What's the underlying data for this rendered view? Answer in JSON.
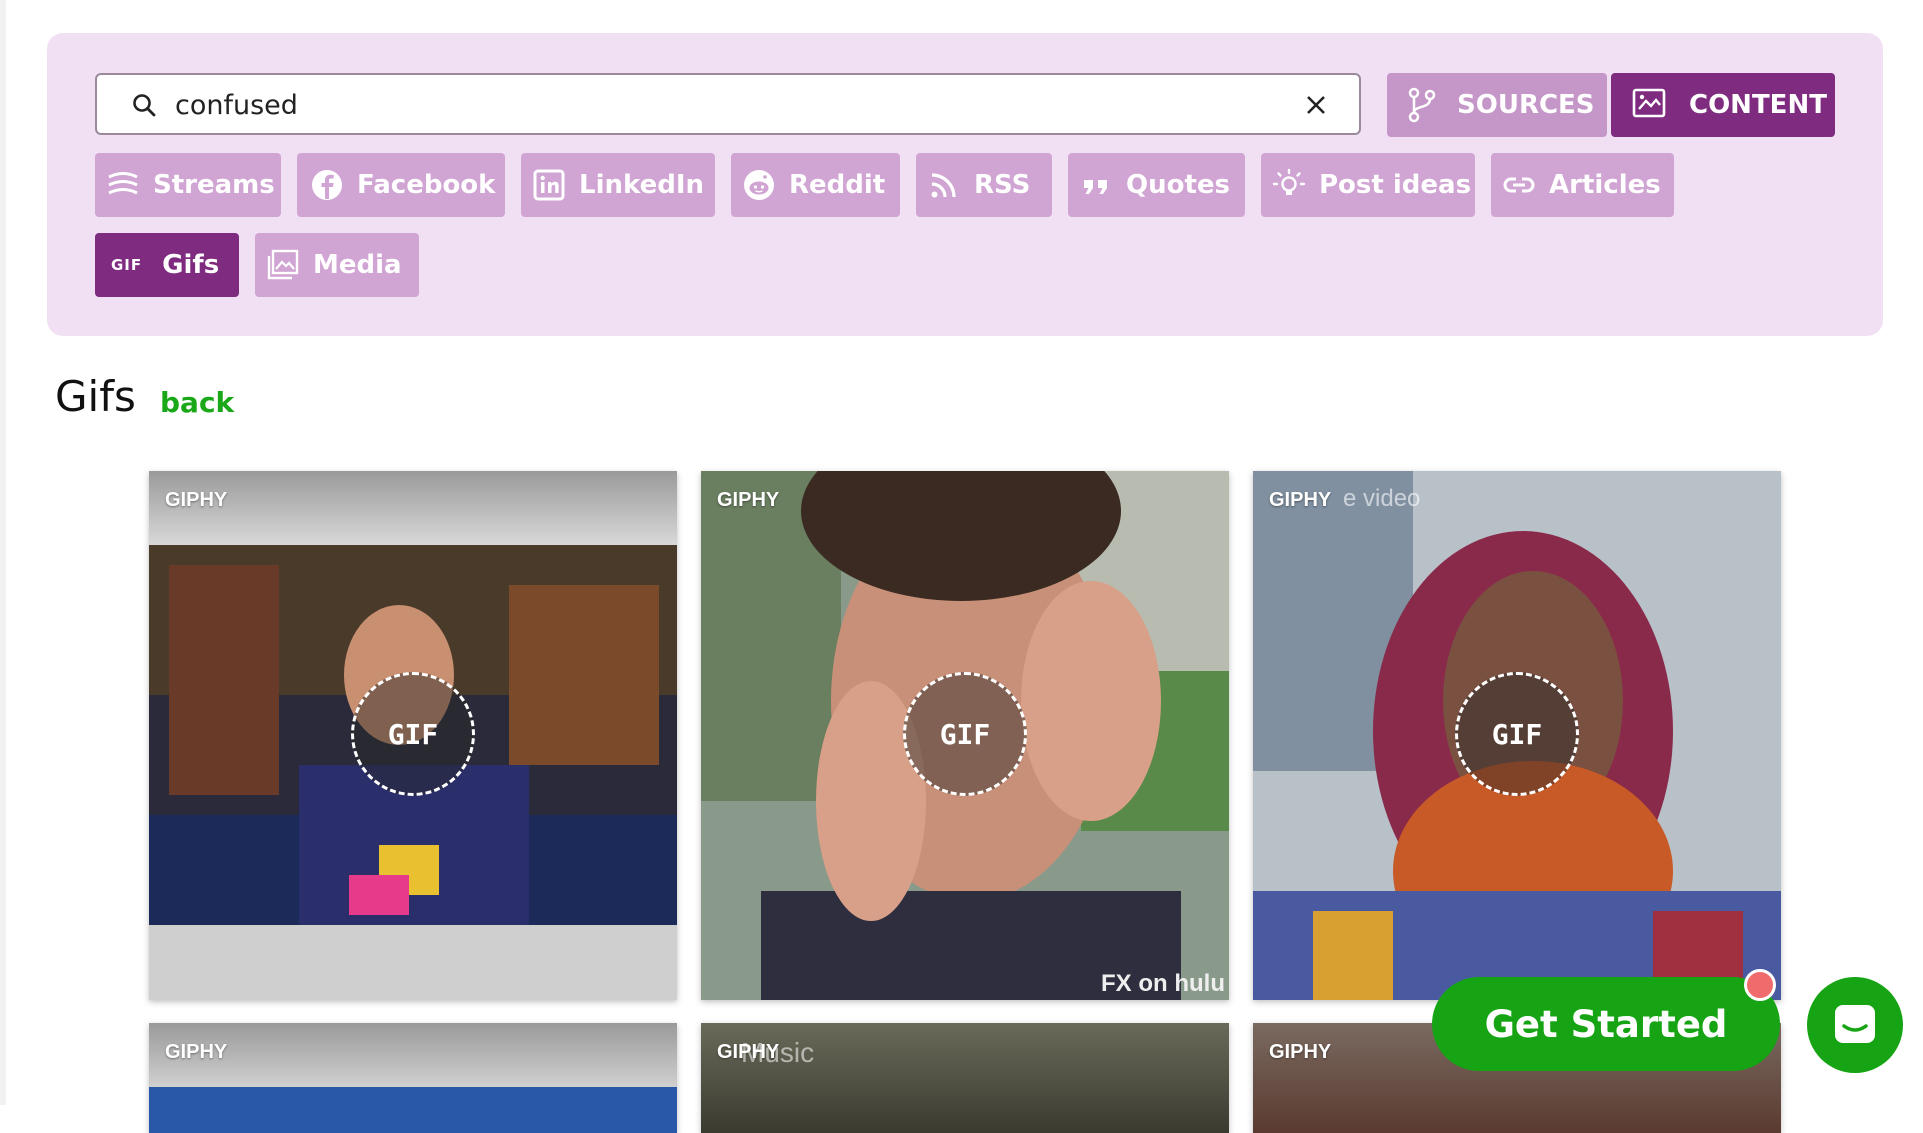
{
  "search": {
    "value": "confused"
  },
  "topbar": {
    "sources_label": "SOURCES",
    "content_label": "CONTENT"
  },
  "chips": [
    {
      "label": "Streams",
      "icon": "streams-icon",
      "active": false
    },
    {
      "label": "Facebook",
      "icon": "facebook-icon",
      "active": false
    },
    {
      "label": "LinkedIn",
      "icon": "linkedin-icon",
      "active": false
    },
    {
      "label": "Reddit",
      "icon": "reddit-icon",
      "active": false
    },
    {
      "label": "RSS",
      "icon": "rss-icon",
      "active": false
    },
    {
      "label": "Quotes",
      "icon": "quotes-icon",
      "active": false
    },
    {
      "label": "Post ideas",
      "icon": "lightbulb-icon",
      "active": false
    },
    {
      "label": "Articles",
      "icon": "link-icon",
      "active": false
    },
    {
      "label": "Gifs",
      "icon": "gif-icon",
      "icon_text": "GIF",
      "active": true
    },
    {
      "label": "Media",
      "icon": "image-icon",
      "active": false
    }
  ],
  "section": {
    "title": "Gifs",
    "back_label": "back"
  },
  "cards": [
    {
      "source": "GIPHY",
      "badge": "GIF"
    },
    {
      "source": "GIPHY",
      "badge": "GIF",
      "watermark": "FX on hulu"
    },
    {
      "source": "GIPHY",
      "badge": "GIF",
      "overlay_text": "e video"
    },
    {
      "source": "GIPHY"
    },
    {
      "source": "GIPHY",
      "overlay_text": "Music"
    },
    {
      "source": "GIPHY"
    }
  ],
  "cta": {
    "label": "Get Started"
  },
  "colors": {
    "accent": "#7e2b80",
    "chip": "#d0a4d3",
    "panel": "#f1e0f3",
    "green": "#16a414"
  }
}
